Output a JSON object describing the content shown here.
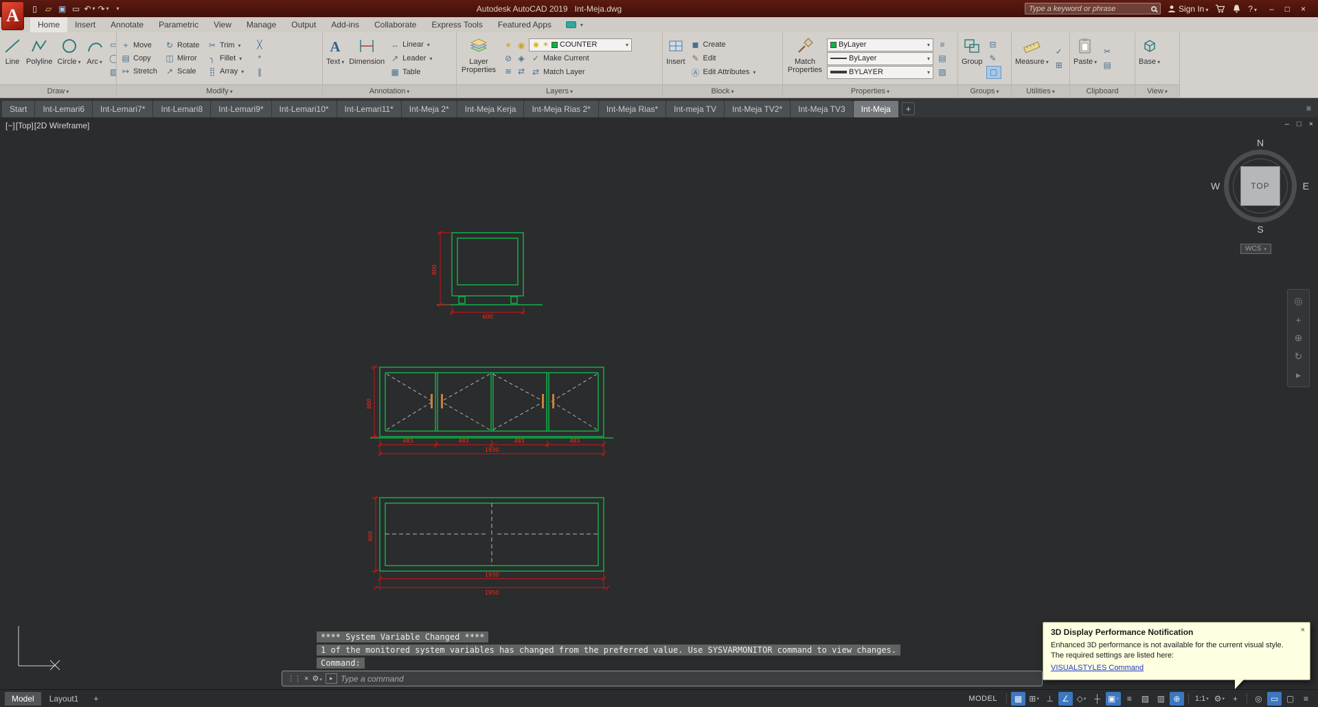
{
  "titlebar": {
    "title": "Autodesk AutoCAD 2019   Int-Meja.dwg",
    "search_placeholder": "Type a keyword or phrase",
    "signin": "Sign In"
  },
  "ribbon": {
    "tabs": [
      "Home",
      "Insert",
      "Annotate",
      "Parametric",
      "View",
      "Manage",
      "Output",
      "Add-ins",
      "Collaborate",
      "Express Tools",
      "Featured Apps"
    ],
    "draw": {
      "label": "Draw",
      "line": "Line",
      "polyline": "Polyline",
      "circle": "Circle",
      "arc": "Arc"
    },
    "modify": {
      "label": "Modify",
      "items": [
        "Move",
        "Rotate",
        "Trim",
        "Copy",
        "Mirror",
        "Fillet",
        "Stretch",
        "Scale",
        "Array"
      ]
    },
    "annotation": {
      "label": "Annotation",
      "text": "Text",
      "dimension": "Dimension",
      "linear": "Linear",
      "leader": "Leader",
      "table": "Table"
    },
    "layers": {
      "label": "Layers",
      "big": "Layer Properties",
      "combo_value": "COUNTER",
      "make_current": "Make Current",
      "match_layer": "Match Layer"
    },
    "block": {
      "label": "Block",
      "insert": "Insert",
      "create": "Create",
      "edit": "Edit",
      "edit_attributes": "Edit Attributes"
    },
    "properties": {
      "label": "Properties",
      "big": "Match Properties",
      "color": "ByLayer",
      "linetype": "ByLayer",
      "lineweight": "BYLAYER"
    },
    "groups": {
      "label": "Groups",
      "big": "Group"
    },
    "utilities": {
      "label": "Utilities",
      "big": "Measure"
    },
    "clipboard": {
      "label": "Clipboard",
      "big": "Paste"
    },
    "view": {
      "label": "View",
      "big": "Base"
    }
  },
  "file_tabs": [
    "Start",
    "Int-Lemari6",
    "Int-Lemari7*",
    "Int-Lemari8",
    "Int-Lemari9*",
    "Int-Lemari10*",
    "Int-Lemari11*",
    "Int-Meja 2*",
    "Int-Meja Kerja",
    "Int-Meja Rias 2*",
    "Int-Meja Rias*",
    "Int-meja TV",
    "Int-Meja TV2*",
    "Int-Meja TV3",
    "Int-Meja"
  ],
  "viewport": {
    "minus": "[−]",
    "view": "[Top]",
    "style": "[2D Wireframe]",
    "cube": {
      "n": "N",
      "e": "E",
      "s": "S",
      "w": "W",
      "face": "TOP"
    },
    "wcs": "WCS"
  },
  "drawing": {
    "front": {
      "height": "800",
      "width": "600"
    },
    "elevation": {
      "height": "800",
      "segments": [
        "483",
        "483",
        "483",
        "483"
      ],
      "total": "1930"
    },
    "plan": {
      "depth": "600",
      "total_inner": "1930",
      "total_outer": "1950"
    }
  },
  "command": {
    "history1": "**** System Variable Changed ****",
    "history2": "1 of the monitored system variables has changed from the preferred value. Use SYSVARMONITOR command to view changes.",
    "history3": "Command:",
    "placeholder": "Type a command"
  },
  "notification": {
    "title": "3D Display Performance Notification",
    "body1": "Enhanced 3D performance is not available for the current visual style.",
    "body2": "The required settings are listed here:",
    "link": "VISUALSTYLES Command"
  },
  "statusbar": {
    "model_tab": "Model",
    "layout_tab": "Layout1",
    "add_layout": "+",
    "model_button": "MODEL",
    "scale": "1:1",
    "toggles": [
      {
        "name": "grid-display",
        "glyph": "▦",
        "active": true
      },
      {
        "name": "snap-mode",
        "glyph": "⊞",
        "active": false
      },
      {
        "name": "ortho-mode",
        "glyph": "⊥",
        "active": false
      },
      {
        "name": "polar-tracking",
        "glyph": "∠",
        "active": true
      },
      {
        "name": "isometric-drafting",
        "glyph": "◇",
        "active": false
      },
      {
        "name": "object-snap-tracking",
        "glyph": "┼",
        "active": false
      },
      {
        "name": "object-snap",
        "glyph": "▣",
        "active": true
      },
      {
        "name": "lineweight",
        "glyph": "≡",
        "active": false
      },
      {
        "name": "transparency",
        "glyph": "▨",
        "active": false
      },
      {
        "name": "selection-cycling",
        "glyph": "▥",
        "active": false
      },
      {
        "name": "dynamic-input",
        "glyph": "⊕",
        "active": true
      }
    ],
    "right_icons": [
      {
        "name": "workspace-switching",
        "glyph": "⚙",
        "active": false
      },
      {
        "name": "annotation-monitor",
        "glyph": "+",
        "active": false
      },
      {
        "name": "isolate-objects",
        "glyph": "◎",
        "active": false
      },
      {
        "name": "graphics-performance",
        "glyph": "▭",
        "active": true
      },
      {
        "name": "clean-screen",
        "glyph": "▢",
        "active": false
      },
      {
        "name": "customization",
        "glyph": "≡",
        "active": false
      }
    ]
  },
  "icons": {
    "app_a": "A",
    "new": "▯",
    "open": "▱",
    "save": "▣",
    "plot": "▭",
    "undo": "↶",
    "redo": "↷",
    "minimize": "–",
    "maximize": "□",
    "close": "×",
    "help": "?",
    "move": "+",
    "rotate": "↻",
    "trim": "✂",
    "copy": "▤",
    "mirror": "◫",
    "fillet": "╮",
    "stretch": "↦",
    "scale": "↗",
    "array": "⣿",
    "erase": "╳",
    "explode": "*",
    "offset": "∥",
    "rect": "▭",
    "ellipse": "◯",
    "hatch": "▨",
    "linear": "↔",
    "leader": "↗",
    "table": "▦",
    "bulb": "◉",
    "sun": "☀",
    "lock": "⊘",
    "make_current": "✓",
    "match_layer": "⇄",
    "layer_tools": [
      "☀",
      "◉",
      "⊘",
      "◈",
      "≋",
      "⇄"
    ],
    "create": "◼",
    "edit": "✎",
    "edit_attr": "Ⓐ",
    "prop_list": "≡",
    "prop_quick": "▤",
    "prop_transp": "▨",
    "ungroup": "⊟",
    "group_edit": "✎",
    "group_select": "▢",
    "quick_select": "✓",
    "quick_calc": "⊞",
    "cut": "✂",
    "copy_clip": "▤",
    "grip": "⋮",
    "wrench": "⚙",
    "prompt": "▸",
    "nav_wheel": "◎",
    "nav_pan": "+",
    "nav_zoom": "⊕",
    "nav_orbit": "↻",
    "nav_motion": "▸"
  }
}
